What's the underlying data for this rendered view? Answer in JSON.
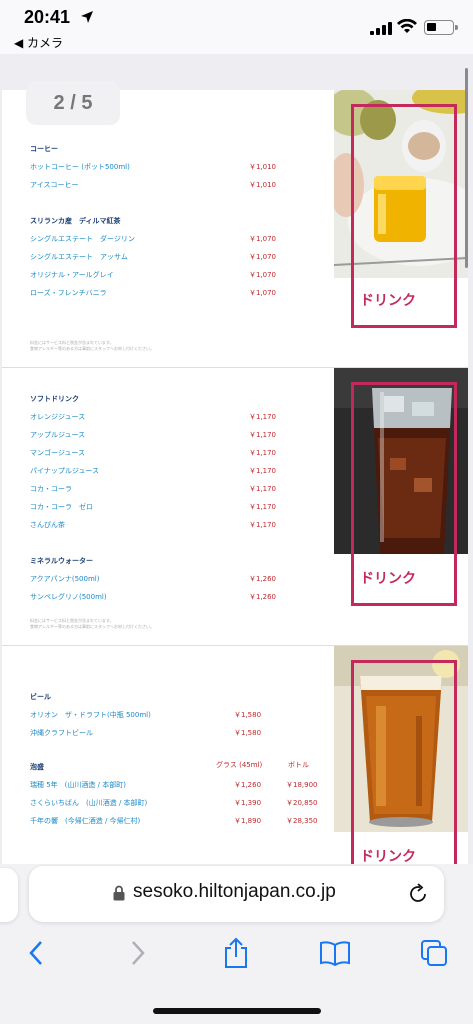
{
  "status_bar": {
    "time": "20:41",
    "back_label": "◀ カメラ"
  },
  "page_indicator": "2 / 5",
  "cards": [
    {
      "sections": [
        {
          "title": "コーヒー",
          "items": [
            {
              "name": "ホットコーヒー (ポット500ml)",
              "price": "￥1,010"
            },
            {
              "name": "アイスコーヒー",
              "price": "￥1,010"
            }
          ]
        },
        {
          "title": "スリランカ産　ディルマ紅茶",
          "items": [
            {
              "name": "シングルエステート　ダージリン",
              "price": "￥1,070"
            },
            {
              "name": "シングルエステート　アッサム",
              "price": "￥1,070"
            },
            {
              "name": "オリジナル・アールグレイ",
              "price": "￥1,070"
            },
            {
              "name": "ローズ・フレンチバニラ",
              "price": "￥1,070"
            }
          ]
        }
      ],
      "footnote": [
        "料金にはサービス料と税金が含まれています。",
        "食物アレルギー等のある方は事前にスタッフへお申し付けください。"
      ],
      "label": "ドリンク"
    },
    {
      "sections": [
        {
          "title": "ソフトドリンク",
          "items": [
            {
              "name": "オレンジジュース",
              "price": "￥1,170"
            },
            {
              "name": "アップルジュース",
              "price": "￥1,170"
            },
            {
              "name": "マンゴージュース",
              "price": "￥1,170"
            },
            {
              "name": "パイナップルジュース",
              "price": "￥1,170"
            },
            {
              "name": "コカ・コーラ",
              "price": "￥1,170"
            },
            {
              "name": "コカ・コーラ　ゼロ",
              "price": "￥1,170"
            },
            {
              "name": "さんぴん茶",
              "price": "￥1,170"
            }
          ]
        },
        {
          "title": "ミネラルウォーター",
          "items": [
            {
              "name": "アクアパンナ(500ml)",
              "price": "￥1,260"
            },
            {
              "name": "サンペレグリノ(500ml)",
              "price": "￥1,260"
            }
          ]
        }
      ],
      "footnote": [
        "料金にはサービス料と税金が含まれています。",
        "食物アレルギー等のある方は事前にスタッフへお申し付けください。"
      ],
      "label": "ドリンク"
    },
    {
      "beer": {
        "title": "ビール",
        "items": [
          {
            "name": "オリオン　ザ・ドラフト(中瓶 500ml)",
            "price": "￥1,580"
          },
          {
            "name": "沖縄クラフトビール",
            "price": "￥1,580"
          }
        ]
      },
      "awamori": {
        "title": "泡盛",
        "col_glass": "グラス (45ml)",
        "col_bottle": "ボトル",
        "items": [
          {
            "name": "瑞穂 5年　(山川酒造 / 本部町)",
            "glass": "￥1,260",
            "bottle": "￥18,900"
          },
          {
            "name": "さくらいちばん　(山川酒造 / 本部町)",
            "glass": "￥1,390",
            "bottle": "￥20,850"
          },
          {
            "name": "千年の響　(今帰仁酒造 / 今帰仁村)",
            "glass": "￥1,890",
            "bottle": "￥28,350"
          }
        ]
      },
      "label": "ドリンク"
    }
  ],
  "browser": {
    "url": "sesoko.hiltonjapan.co.jp"
  },
  "colors": {
    "accent": "#c4295b",
    "link": "#1a8ac8",
    "price": "#c0282d",
    "ios_blue": "#1877f2"
  },
  "icons": [
    "location-arrow-icon",
    "signal-icon",
    "wifi-icon",
    "battery-icon",
    "lock-icon",
    "reload-icon",
    "back-arrow-icon",
    "forward-arrow-icon",
    "share-icon",
    "bookmarks-icon",
    "tabs-icon"
  ]
}
